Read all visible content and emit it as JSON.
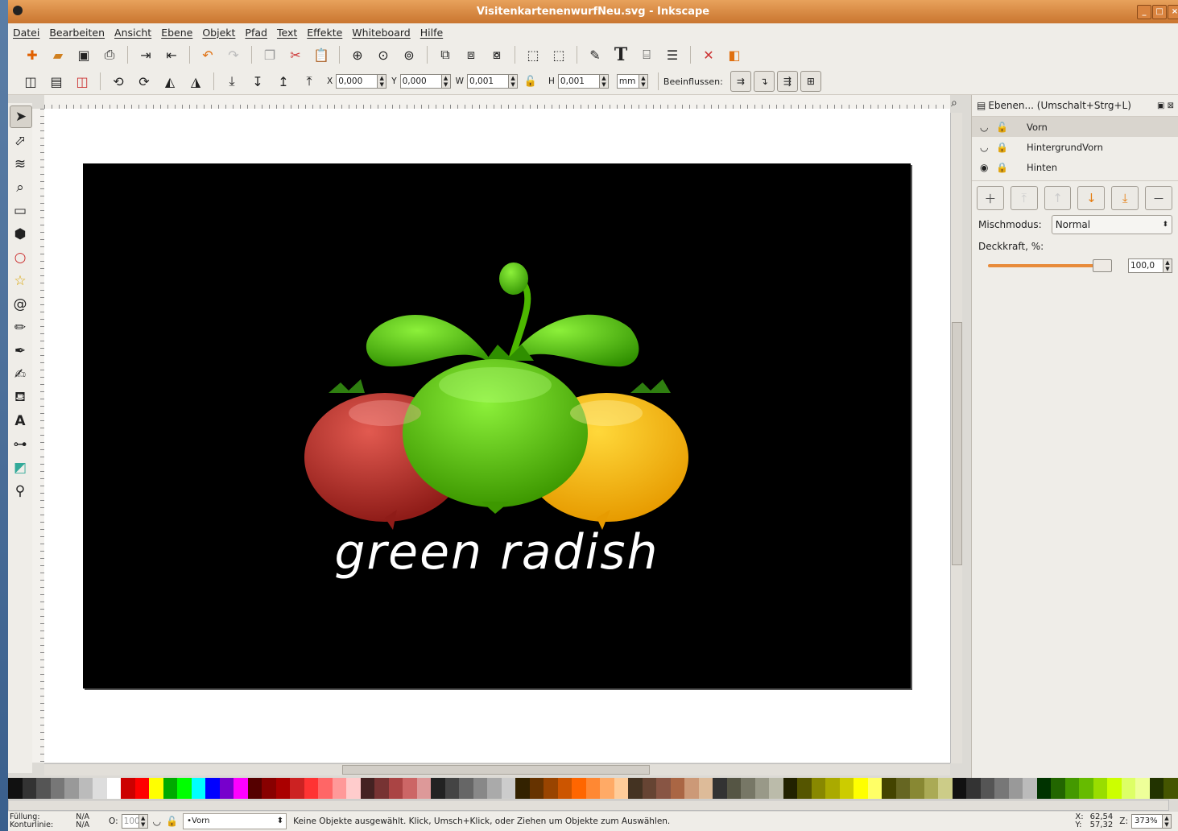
{
  "window": {
    "title": "VisitenkartenenwurfNeu.svg - Inkscape"
  },
  "menu": [
    "Datei",
    "Bearbeiten",
    "Ansicht",
    "Ebene",
    "Objekt",
    "Pfad",
    "Text",
    "Effekte",
    "Whiteboard",
    "Hilfe"
  ],
  "toolbar2": {
    "x_label": "X",
    "x_value": "0,000",
    "y_label": "Y",
    "y_value": "0,000",
    "w_label": "W",
    "w_value": "0,001",
    "h_label": "H",
    "h_value": "0,001",
    "unit": "mm",
    "affect_label": "Beeinflussen:"
  },
  "canvas": {
    "logo_text": "green radish"
  },
  "colors": {
    "page": "#000000",
    "radish_red": "#c0302a",
    "radish_green": "#55c400",
    "radish_yellow": "#f2b800",
    "leaf_green": "#3fb000"
  },
  "layers_panel": {
    "title": "Ebenen... (Umschalt+Strg+L)",
    "layers": [
      {
        "name": "Vorn"
      },
      {
        "name": "HintergrundVorn"
      },
      {
        "name": "Hinten"
      }
    ],
    "blend_label": "Mischmodus:",
    "blend_value": "Normal",
    "opacity_label": "Deckkraft, %:",
    "opacity_value": "100,0"
  },
  "statusbar": {
    "fill_label": "Füllung:",
    "fill_value": "N/A",
    "stroke_label": "Konturlinie:",
    "stroke_value": "N/A",
    "opacity_label": "O:",
    "opacity_value": "100",
    "current_layer": "•Vorn",
    "message": "Keine Objekte ausgewählt. Klick, Umsch+Klick, oder Ziehen um Objekte zum Auswählen.",
    "x_label": "X:",
    "x_coord": "62,54",
    "y_label": "Y:",
    "y_coord": "57,32",
    "zoom_label": "Z:",
    "zoom_value": "373%"
  },
  "palette": [
    "#111111",
    "#333333",
    "#555555",
    "#777777",
    "#999999",
    "#bbbbbb",
    "#dddddd",
    "#ffffff",
    "#cc0000",
    "#ff0000",
    "#ffff00",
    "#00aa00",
    "#00ff00",
    "#00ffff",
    "#0000ff",
    "#7700cc",
    "#ff00ff",
    "#550000",
    "#880000",
    "#aa0000",
    "#cc2222",
    "#ff3333",
    "#ff6666",
    "#ff9999",
    "#ffcccc",
    "#442222",
    "#773333",
    "#aa4444",
    "#cc6666",
    "#dd9999",
    "#222222",
    "#444444",
    "#666666",
    "#888888",
    "#aaaaaa",
    "#cccccc",
    "#332200",
    "#663300",
    "#994400",
    "#cc5500",
    "#ff6600",
    "#ff8833",
    "#ffaa66",
    "#ffcc99",
    "#443322",
    "#664433",
    "#885544",
    "#aa6644",
    "#cc9977",
    "#ddbb99",
    "#333333",
    "#555544",
    "#777766",
    "#999988",
    "#bbbbaa",
    "#222200",
    "#555500",
    "#888800",
    "#aaaa00",
    "#cccc00",
    "#ffff00",
    "#ffff66",
    "#444400",
    "#666622",
    "#888833",
    "#aaaa55",
    "#cccc88",
    "#111111",
    "#333333",
    "#555555",
    "#777777",
    "#999999",
    "#bbbbbb",
    "#003300",
    "#226600",
    "#449900",
    "#66bb00",
    "#99dd00",
    "#ccff00",
    "#ddff66",
    "#eeff99",
    "#223300",
    "#445500"
  ]
}
